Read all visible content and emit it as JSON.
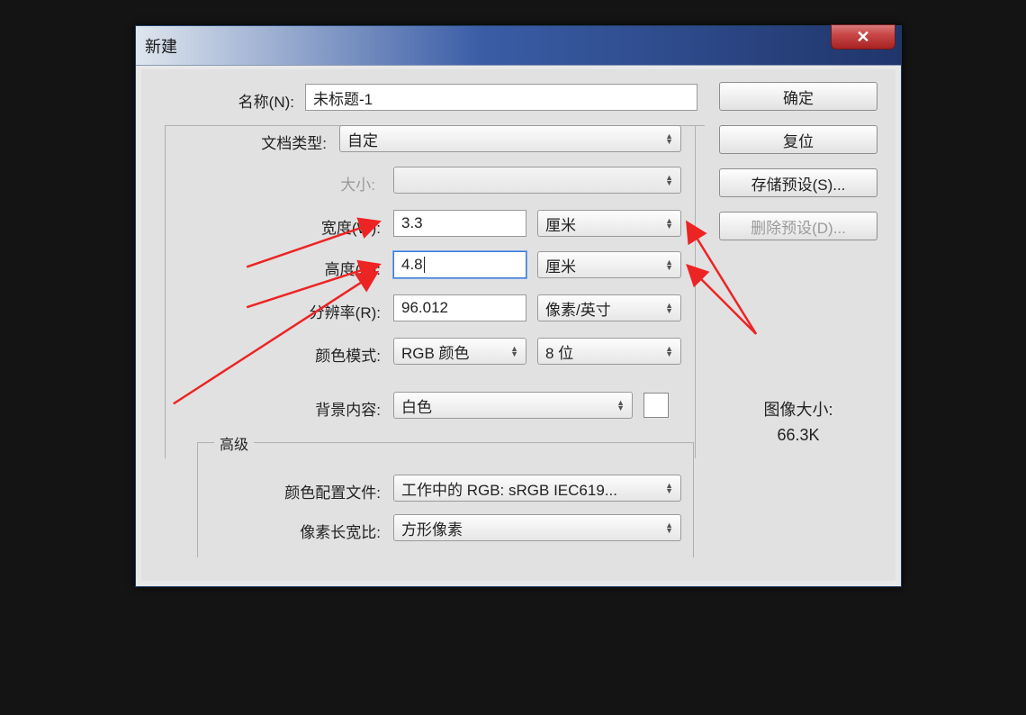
{
  "dialog": {
    "title": "新建",
    "close": "X"
  },
  "name": {
    "label": "名称(N):",
    "value": "未标题-1"
  },
  "docType": {
    "label": "文档类型:",
    "value": "自定"
  },
  "size": {
    "label": "大小:",
    "value": ""
  },
  "width": {
    "label": "宽度(W):",
    "value": "3.3",
    "unit": "厘米"
  },
  "height": {
    "label": "高度(H):",
    "value": "4.8",
    "unit": "厘米"
  },
  "resolution": {
    "label": "分辨率(R):",
    "value": "96.012",
    "unit": "像素/英寸"
  },
  "colorMode": {
    "label": "颜色模式:",
    "value": "RGB 颜色",
    "depth": "8 位"
  },
  "background": {
    "label": "背景内容:",
    "value": "白色"
  },
  "advanced": {
    "legend": "高级",
    "profile": {
      "label": "颜色配置文件:",
      "value": "工作中的 RGB: sRGB IEC619..."
    },
    "aspect": {
      "label": "像素长宽比:",
      "value": "方形像素"
    }
  },
  "buttons": {
    "ok": "确定",
    "reset": "复位",
    "save": "存储预设(S)...",
    "delete": "删除预设(D)..."
  },
  "imageSize": {
    "label": "图像大小:",
    "value": "66.3K"
  }
}
